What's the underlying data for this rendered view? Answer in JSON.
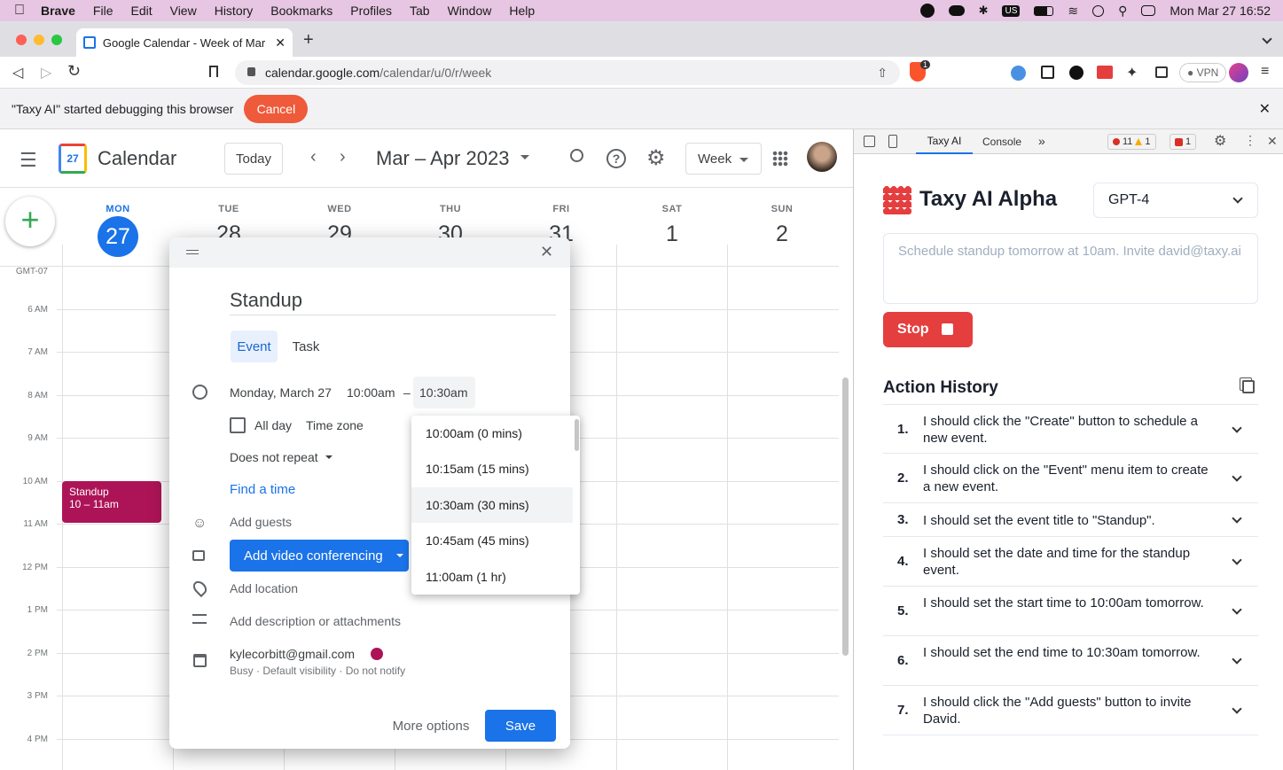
{
  "menubar": {
    "app": "Brave",
    "items": [
      "File",
      "Edit",
      "View",
      "History",
      "Bookmarks",
      "Profiles",
      "Tab",
      "Window",
      "Help"
    ],
    "datetime": "Mon Mar 27  16:52",
    "us": "US"
  },
  "browser": {
    "tab_title": "Google Calendar - Week of Mar",
    "url_host": "calendar.google.com",
    "url_path": "/calendar/u/0/r/week",
    "brave_count": "1",
    "vpn": "VPN"
  },
  "infobar": {
    "text": "\"Taxy AI\" started debugging this browser",
    "cancel": "Cancel"
  },
  "calendar": {
    "app_name": "Calendar",
    "today": "Today",
    "range": "Mar – Apr 2023",
    "view": "Week",
    "timezone": "GMT-07",
    "days": [
      {
        "dow": "MON",
        "num": "27"
      },
      {
        "dow": "TUE",
        "num": "28"
      },
      {
        "dow": "WED",
        "num": "29"
      },
      {
        "dow": "THU",
        "num": "30"
      },
      {
        "dow": "FRI",
        "num": "31"
      },
      {
        "dow": "SAT",
        "num": "1"
      },
      {
        "dow": "SUN",
        "num": "2"
      }
    ],
    "hours": [
      "6 AM",
      "7 AM",
      "8 AM",
      "9 AM",
      "10 AM",
      "11 AM",
      "12 PM",
      "1 PM",
      "2 PM",
      "3 PM",
      "4 PM"
    ],
    "event": {
      "title": "Standup",
      "time": "10 – 11am",
      "color": "#ad1457"
    }
  },
  "dialog": {
    "title": "Standup",
    "tab_event": "Event",
    "tab_task": "Task",
    "date": "Monday, March 27",
    "start": "10:00am",
    "dash": "–",
    "end": "10:30am",
    "allday": "All day",
    "timezone": "Time zone",
    "repeat": "Does not repeat",
    "find_time": "Find a time",
    "add_guests": "Add guests",
    "video": "Add video conferencing",
    "location": "Add location",
    "description": "Add description or attachments",
    "calendar_owner": "kylecorbitt@gmail.com",
    "calendar_sub": "Busy · Default visibility · Do not notify",
    "more_options": "More options",
    "save": "Save"
  },
  "dropdown": {
    "options": [
      "10:00am (0 mins)",
      "10:15am (15 mins)",
      "10:30am (30 mins)",
      "10:45am (45 mins)",
      "11:00am (1 hr)"
    ],
    "selected_index": 2
  },
  "devtools": {
    "tabs": [
      "Taxy AI",
      "Console"
    ],
    "errors": "11",
    "warnings": "1",
    "issues": "1"
  },
  "taxy": {
    "title": "Taxy AI Alpha",
    "model": "GPT-4",
    "prompt": "Schedule standup tomorrow at 10am. Invite david@taxy.ai",
    "stop": "Stop",
    "history_title": "Action History",
    "actions": [
      {
        "n": "1.",
        "text": "I should click the \"Create\" button to schedule a new event."
      },
      {
        "n": "2.",
        "text": "I should click on the \"Event\" menu item to create a new event."
      },
      {
        "n": "3.",
        "text": "I should set the event title to \"Standup\"."
      },
      {
        "n": "4.",
        "text": "I should set the date and time for the standup event."
      },
      {
        "n": "5.",
        "text": "I should set the start time to 10:00am tomorrow."
      },
      {
        "n": "6.",
        "text": "I should set the end time to 10:30am tomorrow."
      },
      {
        "n": "7.",
        "text": "I should click the \"Add guests\" button to invite David."
      }
    ]
  }
}
